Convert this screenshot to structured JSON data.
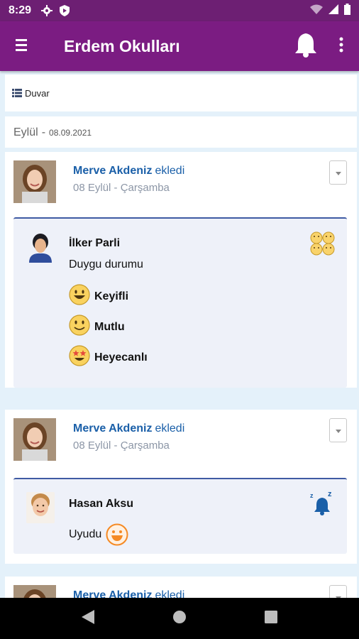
{
  "status_bar": {
    "time": "8:29",
    "icons": [
      "settings-icon",
      "shield-play-icon",
      "wifi-icon",
      "signal-icon",
      "battery-icon"
    ]
  },
  "app_bar": {
    "title": "Erdem Okulları",
    "icons": [
      "menu-icon",
      "bell-icon",
      "more-vert-icon"
    ]
  },
  "wall": {
    "label": "Duvar",
    "icon": "list-icon"
  },
  "month_header": {
    "month": "Eylül",
    "separator": "-",
    "date": "08.09.2021"
  },
  "posts": [
    {
      "author": "Merve Akdeniz",
      "action": "ekledi",
      "when": "08 Eylül - Çarşamba",
      "child": "İlker Parli",
      "label": "Duygu durumu",
      "category_icon": "emotions-icon",
      "moods": [
        {
          "label": "Keyifli",
          "icon": "grinning-face-icon"
        },
        {
          "label": "Mutlu",
          "icon": "smiling-face-icon"
        },
        {
          "label": "Heyecanlı",
          "icon": "star-struck-face-icon"
        }
      ]
    },
    {
      "author": "Merve Akdeniz",
      "action": "ekledi",
      "when": "08 Eylül - Çarşamba",
      "child": "Hasan Aksu",
      "label": "Uyudu",
      "category_icon": "sleep-bell-icon",
      "state_icon": "orange-smile-icon"
    },
    {
      "author": "Merve Akdeniz",
      "action": "ekledi"
    }
  ],
  "colors": {
    "status_bar": "#6d1f73",
    "app_bar": "#7b1c82",
    "background": "#e4f1fa",
    "author_link": "#1a5fa8",
    "accent_border": "#3f5aa3",
    "orange": "#f58a24"
  },
  "nav_bar": {
    "icons": [
      "back-icon",
      "home-icon",
      "recents-icon"
    ]
  }
}
